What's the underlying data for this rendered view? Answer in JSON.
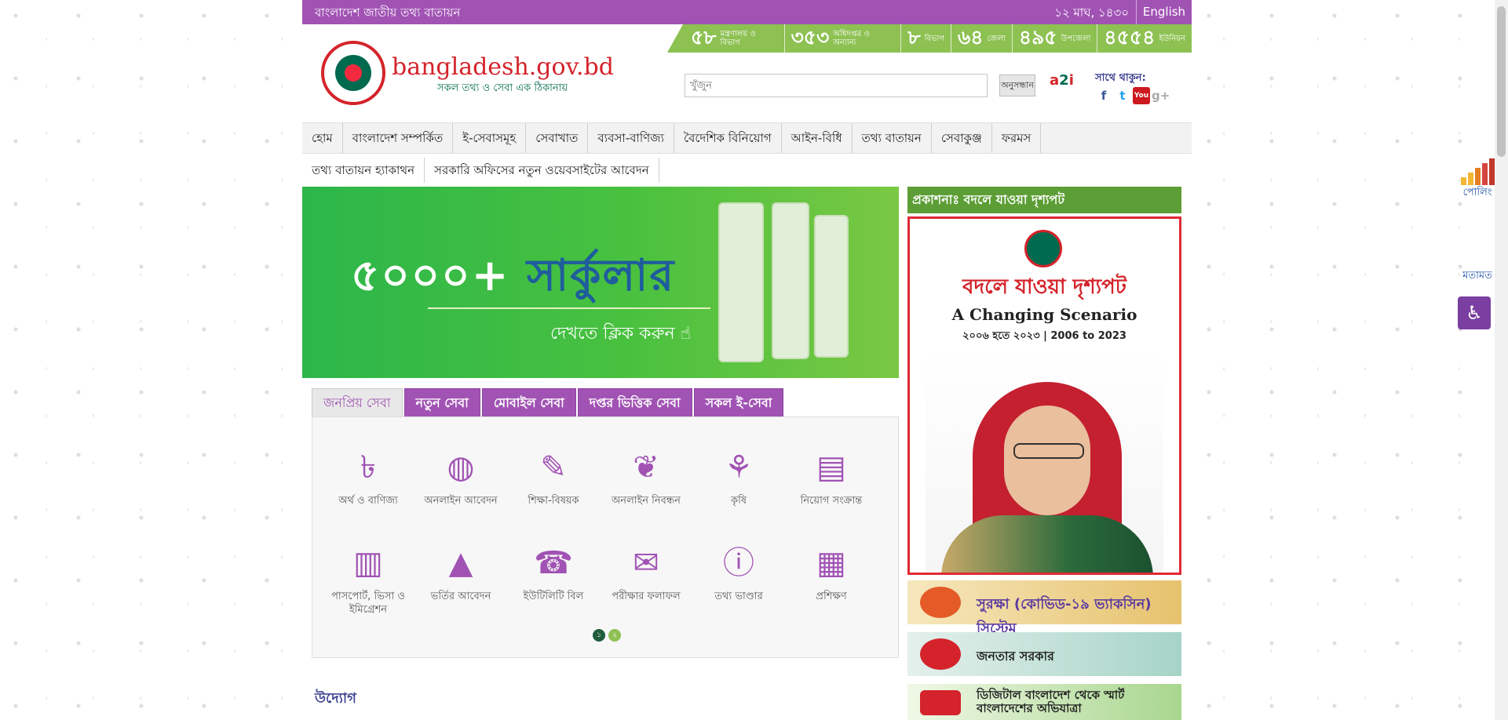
{
  "topbar": {
    "site_title": "বাংলাদেশ জাতীয় তথ্য বাতায়ন",
    "date": "১২ মাঘ, ১৪৩০",
    "lang": "English"
  },
  "stats": [
    {
      "num": "৫৮",
      "label": "মন্ত্রণালয় ও বিভাগ"
    },
    {
      "num": "৩৫৩",
      "label": "অধিদপ্তর ও অন্যান্য"
    },
    {
      "num": "৮",
      "label": "বিভাগ"
    },
    {
      "num": "৬৪",
      "label": "জেলা"
    },
    {
      "num": "৪৯৫",
      "label": "উপজেলা"
    },
    {
      "num": "৪৫৫৪",
      "label": "ইউনিয়ন"
    }
  ],
  "brand": {
    "name": "bangladesh.gov.bd",
    "tagline": "সকল তথ্য ও সেবা এক ঠিকানায়"
  },
  "search": {
    "placeholder": "খুঁজুন",
    "button": "অনুসন্ধান"
  },
  "follow_label": "সাথে থাকুন:",
  "social": [
    {
      "icon": "facebook-icon",
      "glyph": "f",
      "color": "#3b5998"
    },
    {
      "icon": "twitter-icon",
      "glyph": "t",
      "color": "#1da1f2"
    },
    {
      "icon": "youtube-icon",
      "glyph": "You",
      "color": "#cc181e"
    },
    {
      "icon": "google-plus-icon",
      "glyph": "g+",
      "color": "#aaaaaa"
    }
  ],
  "nav": [
    "হোম",
    "বাংলাদেশ সম্পর্কিত",
    "ই-সেবাসমূহ",
    "সেবাখাত",
    "ব্যবসা-বাণিজ্য",
    "বৈদেশিক বিনিয়োগ",
    "আইন-বিধি",
    "তথ্য বাতায়ন",
    "সেবাকুঞ্জ",
    "ফরমস"
  ],
  "subnav": [
    "তথ্য বাতায়ন হ্যাকাথন",
    "সরকারি অফিসের নতুন ওয়েবসাইটের আবেদন"
  ],
  "banner": {
    "headline_num": "৫০০০+",
    "headline_word": "সার্কুলার",
    "cta": "দেখতে ক্লিক করুন"
  },
  "tabs": [
    "জনপ্রিয় সেবা",
    "নতুন সেবা",
    "মোবাইল সেবা",
    "দপ্তর ভিত্তিক সেবা",
    "সকল ই-সেবা"
  ],
  "services": [
    {
      "label": "অর্থ ও বাণিজ্য",
      "icon": "finance-icon",
      "glyph": "৳"
    },
    {
      "label": "অনলাইন আবেদন",
      "icon": "globe-icon",
      "glyph": "◍"
    },
    {
      "label": "শিক্ষা-বিষয়ক",
      "icon": "education-icon",
      "glyph": "✎"
    },
    {
      "label": "অনলাইন নিবন্ধন",
      "icon": "footprint-icon",
      "glyph": "❦"
    },
    {
      "label": "কৃষি",
      "icon": "agriculture-icon",
      "glyph": "⚘"
    },
    {
      "label": "নিয়োগ সংক্রান্ত",
      "icon": "recruitment-icon",
      "glyph": "▤"
    },
    {
      "label": "পাসপোর্ট, ভিসা ও ইমিগ্রেশন",
      "icon": "passport-icon",
      "glyph": "▥"
    },
    {
      "label": "ভর্তির আবেদন",
      "icon": "graduation-cap-icon",
      "glyph": "▲"
    },
    {
      "label": "ইউটিলিটি বিল",
      "icon": "telephone-icon",
      "glyph": "☎"
    },
    {
      "label": "পরীক্ষার ফলাফল",
      "icon": "exam-result-icon",
      "glyph": "✉"
    },
    {
      "label": "তথ্য ভাণ্ডার",
      "icon": "info-icon",
      "glyph": "ⓘ"
    },
    {
      "label": "প্রশিক্ষণ",
      "icon": "training-icon",
      "glyph": "▦"
    }
  ],
  "pager": [
    "১",
    "২"
  ],
  "section_heading": "উদ্যোগ",
  "publication": {
    "heading": "প্রকাশনাঃ বদলে যাওয়া দৃশ্যপট",
    "title_bn": "বদলে যাওয়া দৃশ্যপট",
    "title_en": "A Changing Scenario",
    "years": "২০০৬ হতে ২০২৩ | 2006 to 2023"
  },
  "promos": [
    {
      "text": "সুরক্ষা (কোভিড-১৯ ভ্যাকসিন) সিস্টেম"
    },
    {
      "text": "জনতার সরকার"
    },
    {
      "text": "ডিজিটাল বাংলাদেশ থেকে স্মার্ট বাংলাদেশের অভিযাত্রা"
    }
  ],
  "side": {
    "poll": "পোলিং",
    "opinion": "মতামত"
  }
}
